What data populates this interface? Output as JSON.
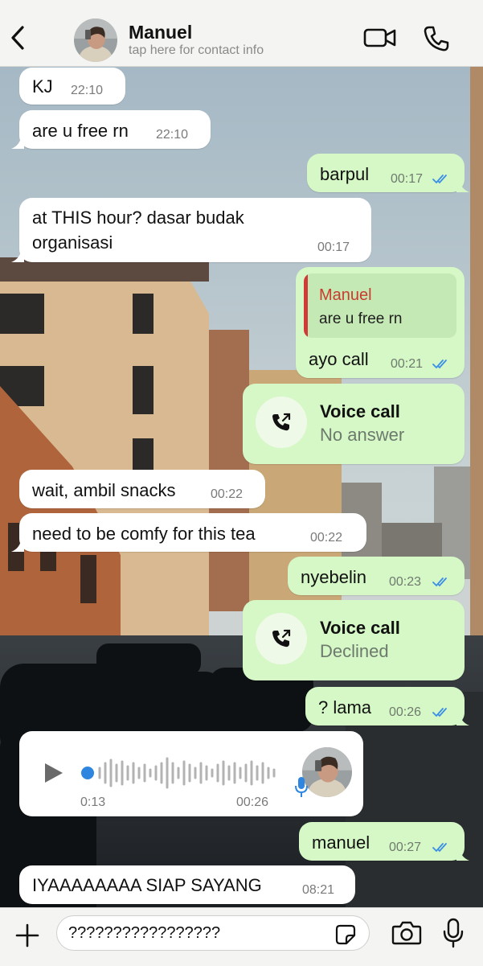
{
  "header": {
    "contact_name": "Manuel",
    "subtitle": "tap here for contact info"
  },
  "colors": {
    "bubble_in": "#ffffff",
    "bubble_out": "#d5f8c6",
    "read_tick": "#3b8ee6",
    "quote_name": "#c93c2e"
  },
  "messages": [
    {
      "dir": "in",
      "text": "KJ",
      "time": "22:10"
    },
    {
      "dir": "in",
      "text": "are u free rn",
      "time": "22:10"
    },
    {
      "dir": "out",
      "text": "barpul",
      "time": "00:17",
      "status": "read"
    },
    {
      "dir": "in",
      "text_line1": "at THIS hour? dasar budak",
      "text_line2": "organisasi",
      "time": "00:17"
    },
    {
      "dir": "out",
      "quote_author": "Manuel",
      "quote_text": "are u free rn",
      "text": "ayo call",
      "time": "00:21",
      "status": "read"
    },
    {
      "dir": "out",
      "type": "call",
      "title": "Voice call",
      "status_text": "No answer"
    },
    {
      "dir": "in",
      "text": "wait, ambil snacks",
      "time": "00:22"
    },
    {
      "dir": "in",
      "text": "need to be comfy for this tea",
      "time": "00:22"
    },
    {
      "dir": "out",
      "text": "nyebelin",
      "time": "00:23",
      "status": "read"
    },
    {
      "dir": "out",
      "type": "call",
      "title": "Voice call",
      "status_text": "Declined"
    },
    {
      "dir": "out",
      "text": "? lama",
      "time": "00:26",
      "status": "read"
    },
    {
      "dir": "in",
      "type": "voice",
      "duration": "0:13",
      "time": "00:26"
    },
    {
      "dir": "out",
      "text": "manuel",
      "time": "00:27",
      "status": "read"
    },
    {
      "dir": "in",
      "text": "IYAAAAAAAA SIAP SAYANG",
      "time": "08:21"
    }
  ],
  "composer": {
    "value": "?????????????????"
  },
  "icons": {
    "back": "chevron-left-icon",
    "video": "video-camera-icon",
    "phone": "phone-icon",
    "plus": "plus-icon",
    "sticker": "sticker-icon",
    "camera": "camera-icon",
    "mic": "microphone-icon"
  }
}
